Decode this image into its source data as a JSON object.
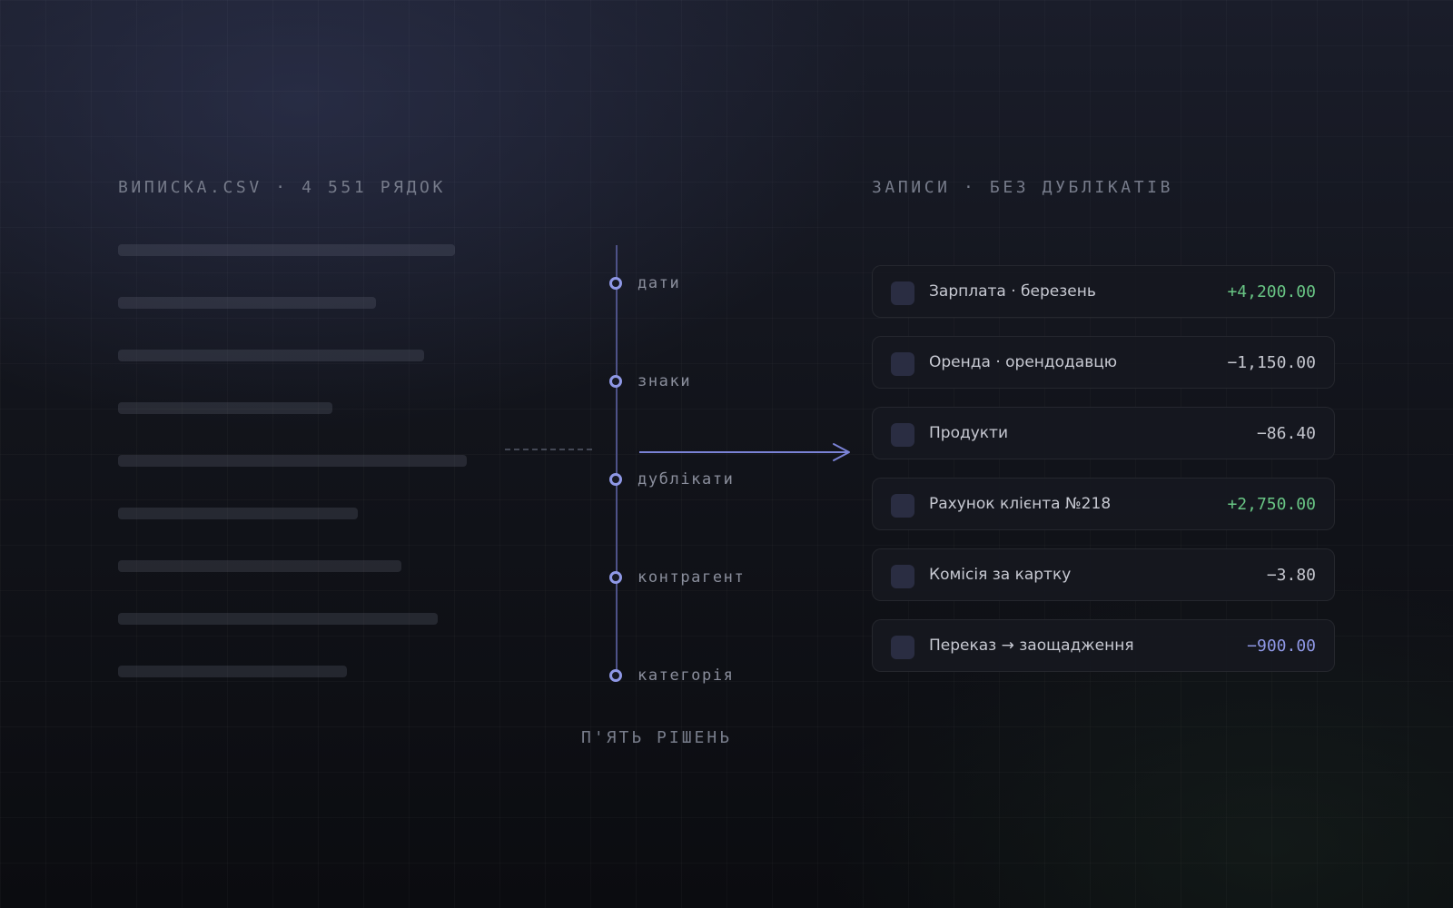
{
  "source": {
    "heading": "ВИПИСКА.CSV · 4 551 РЯДОК",
    "placeholder_line_count": 9
  },
  "pipeline": {
    "steps": [
      {
        "label": "дати"
      },
      {
        "label": "знаки"
      },
      {
        "label": "дублікати"
      },
      {
        "label": "контрагент"
      },
      {
        "label": "категорія"
      }
    ],
    "caption": "П'ЯТЬ РІШЕНЬ",
    "accent_color": "#8f98e6"
  },
  "records": {
    "heading": "ЗАПИСИ · БЕЗ ДУБЛІКАТІВ",
    "items": [
      {
        "label": "Зарплата · березень",
        "amount": "+4,200.00",
        "kind": "income"
      },
      {
        "label": "Оренда · орендодавцю",
        "amount": "−1,150.00",
        "kind": "expense"
      },
      {
        "label": "Продукти",
        "amount": "−86.40",
        "kind": "expense"
      },
      {
        "label": "Рахунок клієнта №218",
        "amount": "+2,750.00",
        "kind": "income"
      },
      {
        "label": "Комісія за картку",
        "amount": "−3.80",
        "kind": "expense"
      },
      {
        "label": "Переказ → заощадження",
        "amount": "−900.00",
        "kind": "transfer"
      }
    ]
  },
  "colors": {
    "income": "#69c685",
    "expense": "#c4c6ce",
    "transfer": "#8f98e6"
  }
}
